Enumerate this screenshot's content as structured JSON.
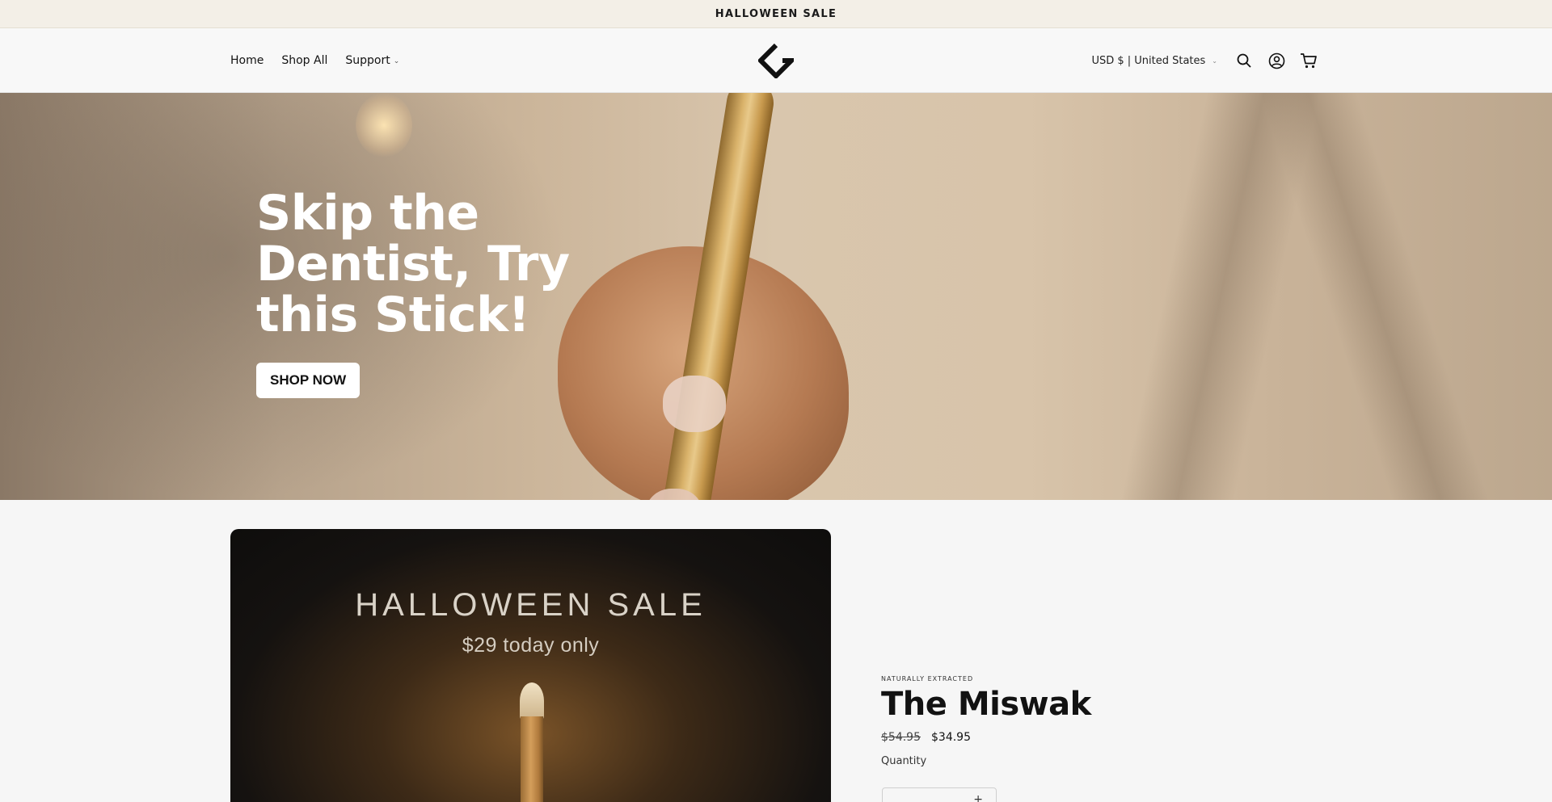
{
  "announcement": {
    "text": "HALLOWEEN SALE"
  },
  "nav": {
    "items": [
      {
        "label": "Home"
      },
      {
        "label": "Shop All"
      },
      {
        "label": "Support"
      }
    ]
  },
  "header": {
    "currency": "USD $ | United States",
    "icons": [
      "search-icon",
      "account-icon",
      "cart-icon"
    ]
  },
  "hero": {
    "title": "Skip the Dentist, Try this Stick!",
    "button_label": "SHOP NOW"
  },
  "product": {
    "media_title": "HALLOWEEN SALE",
    "media_subtitle": "$29 today only",
    "eyebrow": "NATURALLY EXTRACTED",
    "title": "The Miswak",
    "price_old": "$54.95",
    "price_new": "$34.95",
    "quantity_label": "Quantity",
    "quantity_plus": "+"
  }
}
